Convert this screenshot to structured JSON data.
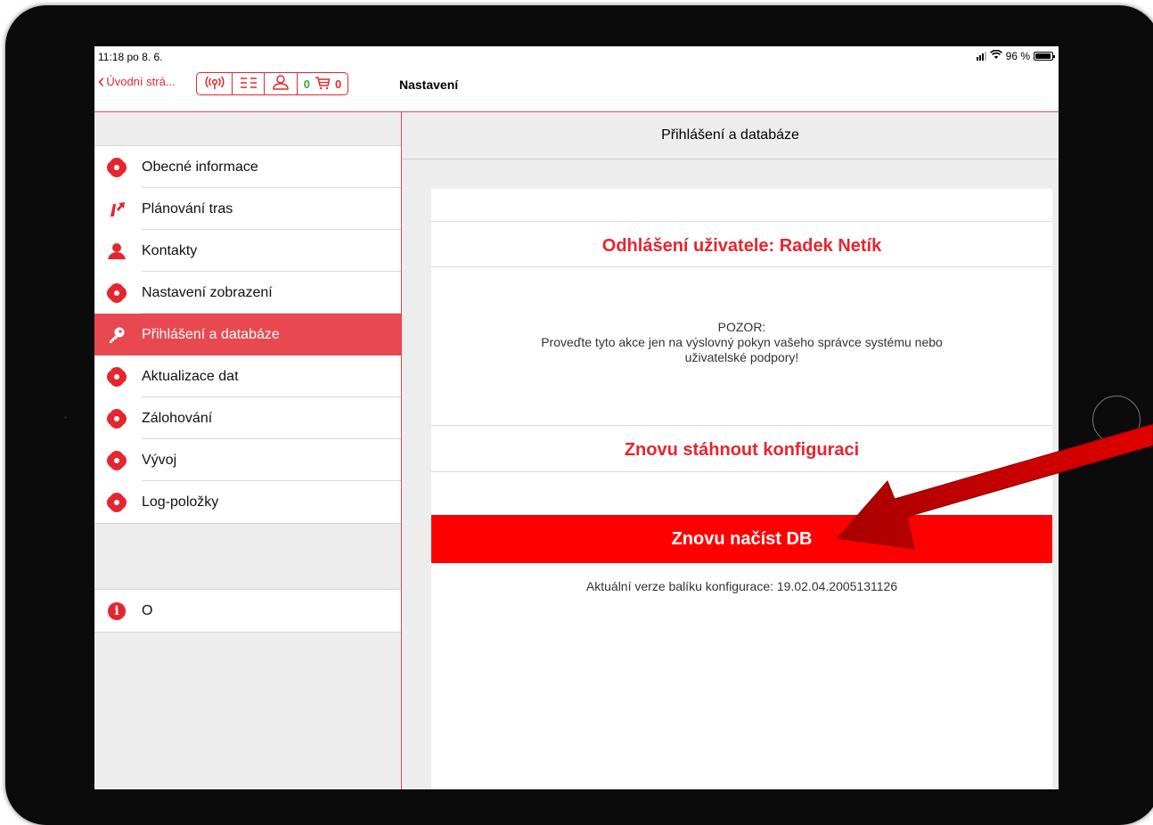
{
  "status": {
    "time": "11:18  po 8. 6.",
    "battery": "96 %"
  },
  "nav": {
    "back_label": "Úvodní strá...",
    "title": "Nastavení",
    "cart_left": "0",
    "cart_right": "0"
  },
  "sidebar": {
    "items": [
      {
        "label": "Obecné informace",
        "icon": "gear-icon"
      },
      {
        "label": "Plánování tras",
        "icon": "route-icon"
      },
      {
        "label": "Kontakty",
        "icon": "contact-icon"
      },
      {
        "label": "Nastavení zobrazení",
        "icon": "gear-icon"
      },
      {
        "label": "Přihlášení a databáze",
        "icon": "key-icon",
        "active": true
      },
      {
        "label": "Aktualizace dat",
        "icon": "gear-icon"
      },
      {
        "label": "Zálohování",
        "icon": "gear-icon"
      },
      {
        "label": "Vývoj",
        "icon": "gear-icon"
      },
      {
        "label": "Log-položky",
        "icon": "gear-icon"
      }
    ],
    "about": {
      "label": "O",
      "icon": "info-icon"
    }
  },
  "detail": {
    "header": "Přihlášení a databáze",
    "logout_label": "Odhlášení uživatele: Radek Netík",
    "warning_title": "POZOR:",
    "warning_line1": "Proveďte tyto akce jen na výslovný pokyn vašeho správce systému nebo",
    "warning_line2": "uživatelské podpory!",
    "redownload_label": "Znovu stáhnout konfiguraci",
    "reload_db_label": "Znovu načíst DB",
    "version_text": "Aktuální verze balíku konfigurace: 19.02.04.2005131126"
  },
  "colors": {
    "accent": "#e5262f",
    "active_row": "#e84951",
    "reload_button": "#ff0000",
    "arrow": "#d40000"
  }
}
